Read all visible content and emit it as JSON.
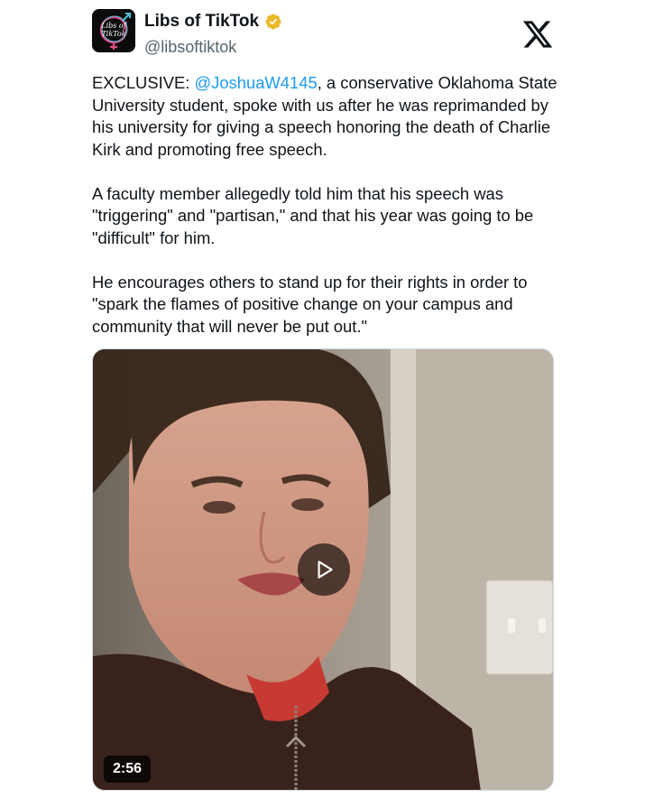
{
  "tweet": {
    "author": {
      "display_name": "Libs of TikTok",
      "handle": "@libsoftiktok",
      "avatar_text": "Libs of TikTok",
      "verified_icon": "verified-badge-icon",
      "verified_color": "#e8b829"
    },
    "platform_icon": "x-logo-icon",
    "body": {
      "p1_prefix": "EXCLUSIVE: ",
      "p1_mention": "@JoshuaW4145",
      "p1_rest": ", a conservative Oklahoma State University student, spoke with us after he was reprimanded by his university for giving a speech honoring the death of Charlie Kirk and promoting free speech.",
      "p2": "A faculty member allegedly told him that his speech was \"triggering\" and \"partisan,\" and that his year was going to be \"difficult\" for him.",
      "p3": "He encourages others to stand up for their rights in order to \"spark the flames of positive change on your campus and community that will never be put out.\""
    },
    "media": {
      "type": "video",
      "duration": "2:56",
      "play_icon": "play-icon"
    },
    "colors": {
      "mention": "#1d9bf0",
      "text": "#0f1419",
      "secondary": "#536471"
    }
  }
}
